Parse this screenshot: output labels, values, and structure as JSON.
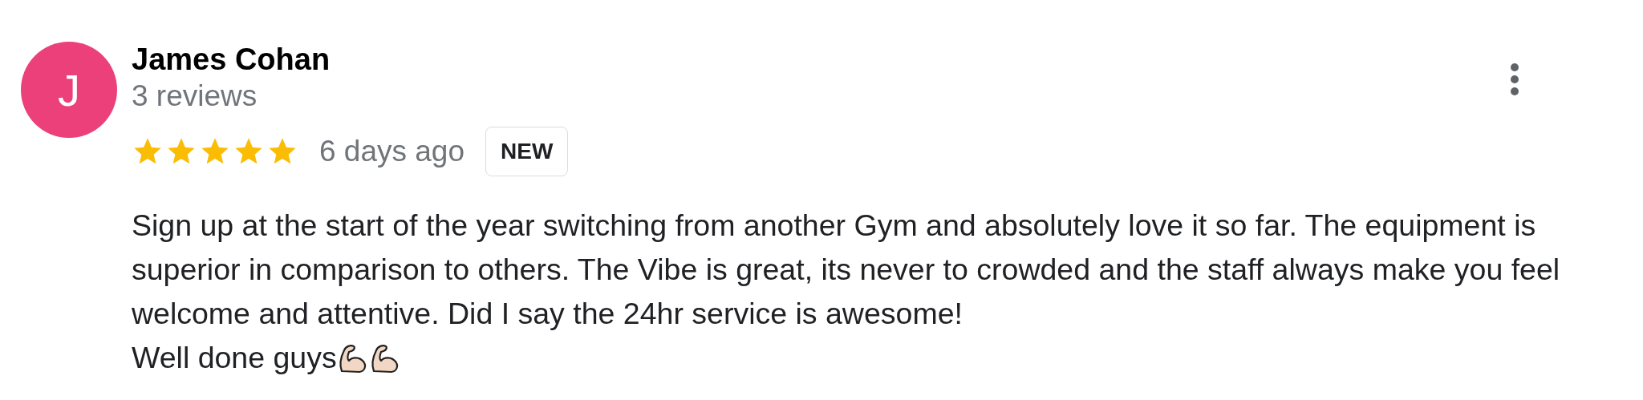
{
  "review": {
    "avatar_letter": "J",
    "author": "James Cohan",
    "review_count": "3 reviews",
    "stars": 5,
    "time": "6 days ago",
    "badge": "NEW",
    "body": [
      "Sign up at the start of the year switching from another Gym and absolutely love it so far. The equipment is superior in comparison to others. The Vibe is great, its never to crowded and the staff always make you feel welcome and attentive. Did I say the 24hr service is awesome!",
      "Well done guys"
    ]
  }
}
